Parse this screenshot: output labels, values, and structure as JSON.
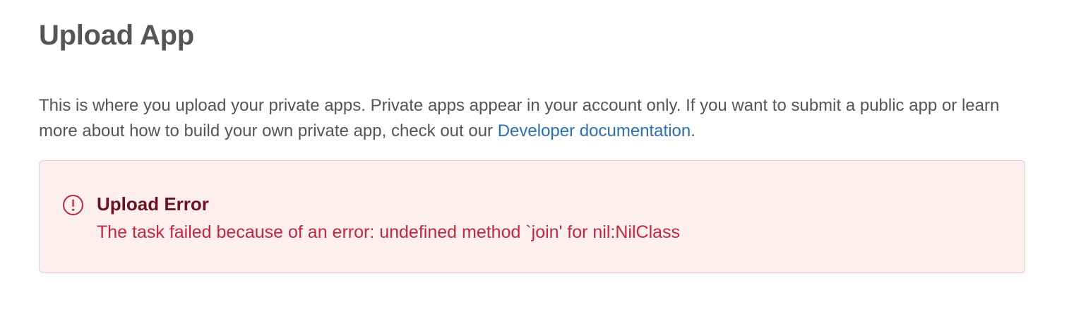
{
  "header": {
    "title": "Upload App"
  },
  "intro": {
    "text_before_link": "This is where you upload your private apps. Private apps appear in your account only. If you want to submit a public app or learn more about how to build your own private app, check out our ",
    "link_label": "Developer documentation",
    "text_after_link": "."
  },
  "alert": {
    "icon": "alert-circle-icon",
    "title": "Upload Error",
    "message": "The task failed because of an error: undefined method `join' for nil:NilClass"
  },
  "colors": {
    "title": "#555555",
    "body_text": "#555555",
    "link": "#2a70b0",
    "alert_background": "#fdeef0",
    "alert_border": "#f2c6cd",
    "alert_title": "#6b1420",
    "alert_message": "#c4283e"
  }
}
